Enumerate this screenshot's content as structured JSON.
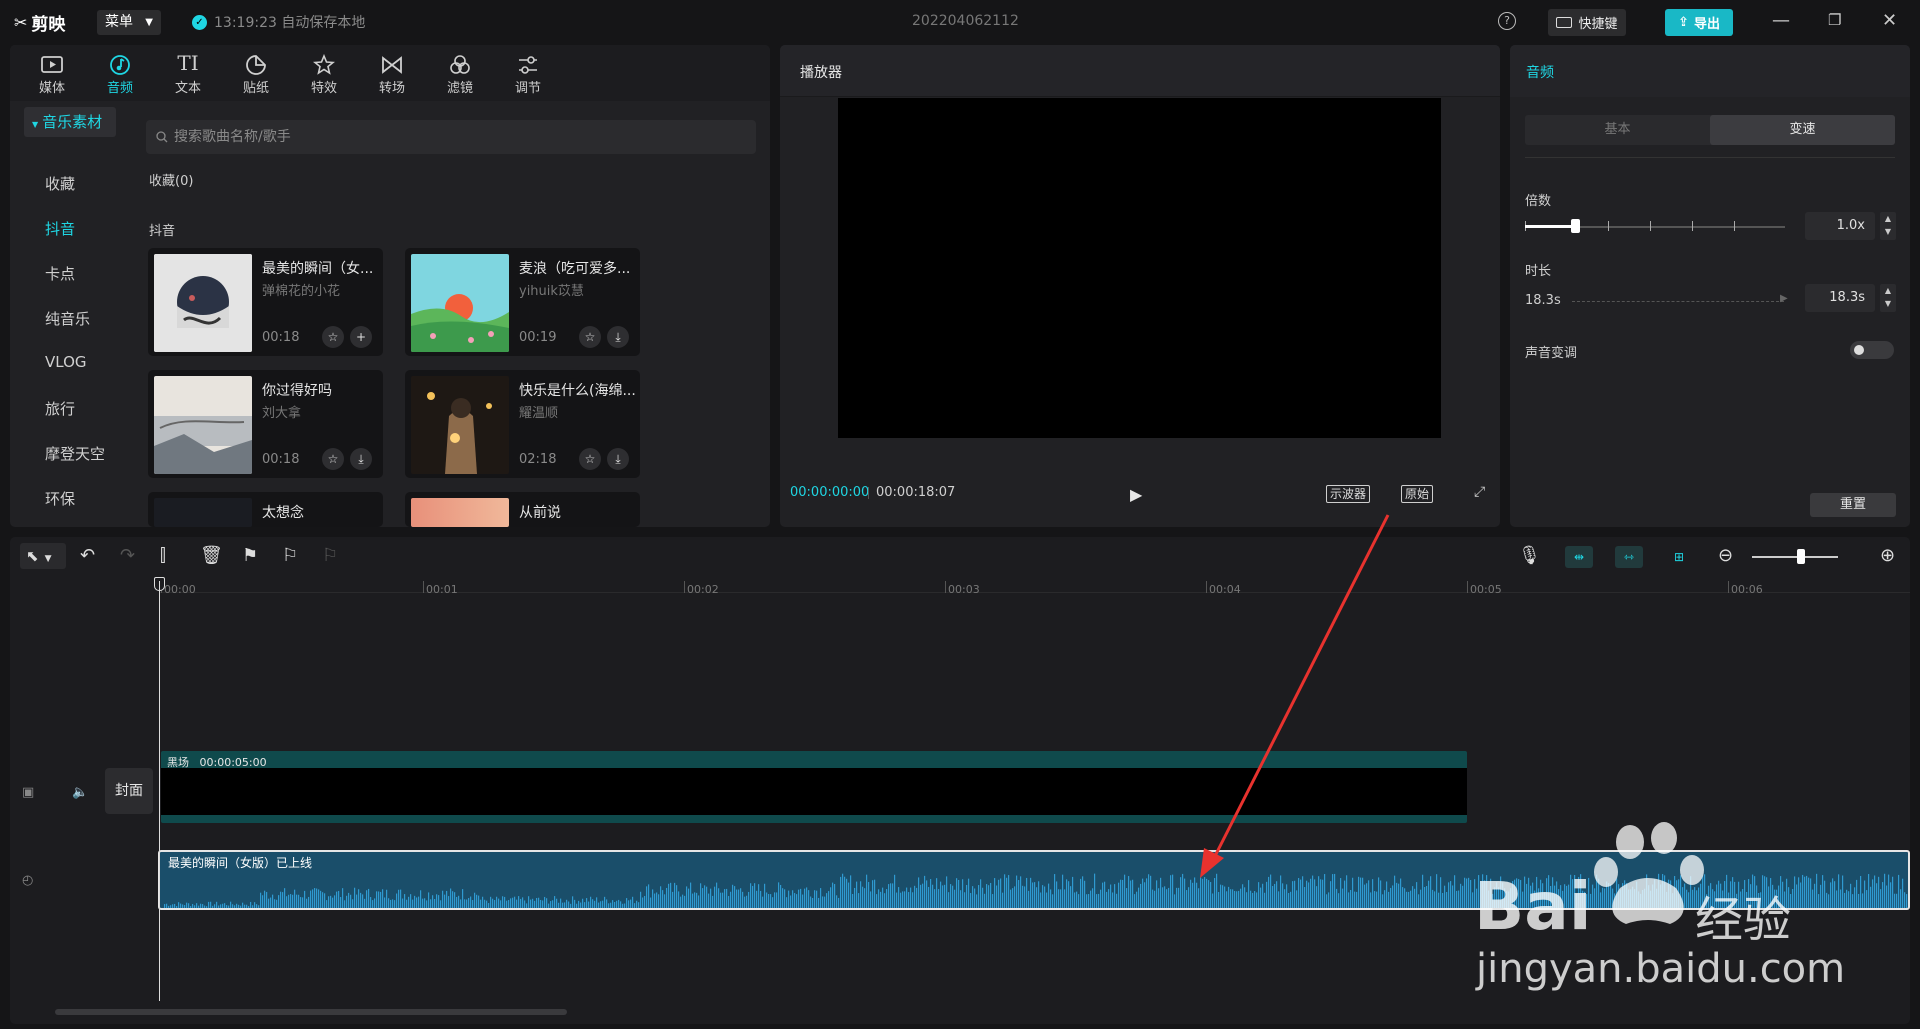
{
  "app": {
    "logo_text": "剪映",
    "menu_label": "菜单",
    "autosave_text": "13:19:23 自动保存本地",
    "project_title": "202204062112",
    "help_symbol": "?",
    "shortcut_label": "快捷键",
    "export_label": "导出"
  },
  "toolbar": {
    "items": [
      {
        "label": "媒体",
        "icon": "media-icon"
      },
      {
        "label": "音频",
        "icon": "audio-icon",
        "active": true
      },
      {
        "label": "文本",
        "icon": "text-icon",
        "glyph": "TI"
      },
      {
        "label": "贴纸",
        "icon": "sticker-icon"
      },
      {
        "label": "特效",
        "icon": "effects-icon"
      },
      {
        "label": "转场",
        "icon": "transition-icon"
      },
      {
        "label": "滤镜",
        "icon": "filter-icon"
      },
      {
        "label": "调节",
        "icon": "adjust-icon"
      }
    ]
  },
  "sidebar": {
    "header": "音乐素材",
    "items": [
      "收藏",
      "抖音",
      "卡点",
      "纯音乐",
      "VLOG",
      "旅行",
      "摩登天空",
      "环保"
    ],
    "active": "抖音"
  },
  "library": {
    "search_placeholder": "搜索歌曲名称/歌手",
    "favorites_label": "收藏(0)",
    "section_label": "抖音",
    "songs": [
      {
        "title": "最美的瞬间（女...",
        "artist": "弹棉花的小花",
        "duration": "00:18",
        "action": "add"
      },
      {
        "title": "麦浪（吃可爱多...",
        "artist": "yihuik苡慧",
        "duration": "00:19",
        "action": "download"
      },
      {
        "title": "你过得好吗",
        "artist": "刘大拿",
        "duration": "00:18",
        "action": "download"
      },
      {
        "title": "快乐是什么(海绵...",
        "artist": "耀温顺",
        "duration": "02:18",
        "action": "download"
      },
      {
        "title": "太想念",
        "artist": "",
        "duration": "",
        "action": ""
      },
      {
        "title": "从前说",
        "artist": "",
        "duration": "",
        "action": ""
      }
    ]
  },
  "player": {
    "title": "播放器",
    "current_time": "00:00:00:00",
    "total_time": "00:00:18:07",
    "scope_label": "示波器",
    "original_label": "原始"
  },
  "inspector": {
    "title": "音频",
    "tabs": [
      "基本",
      "变速"
    ],
    "active_tab": "变速",
    "speed_label": "倍数",
    "speed_value": "1.0x",
    "speed_fraction": 0.2,
    "duration_label": "时长",
    "duration_left": "18.3s",
    "duration_value": "18.3s",
    "pitch_label": "声音变调",
    "pitch_on": false,
    "reset_label": "重置"
  },
  "timeline": {
    "ruler_ticks": [
      "00:00",
      "00:01",
      "00:02",
      "00:03",
      "00:04",
      "00:05",
      "00:06"
    ],
    "cover_label": "封面",
    "video_clip_label": "黑场",
    "video_clip_duration": "00:00:05:00",
    "audio_clip_label": "最美的瞬间（女版）已上线",
    "zoom_fraction": 0.52
  },
  "watermark": {
    "brand": "Bai",
    "brand_cn": "经验",
    "url": "jingyan.baidu.com"
  },
  "colors": {
    "accent": "#1fd6e3",
    "export_bg": "#19b8c6",
    "annotation_arrow": "#e8322e"
  }
}
